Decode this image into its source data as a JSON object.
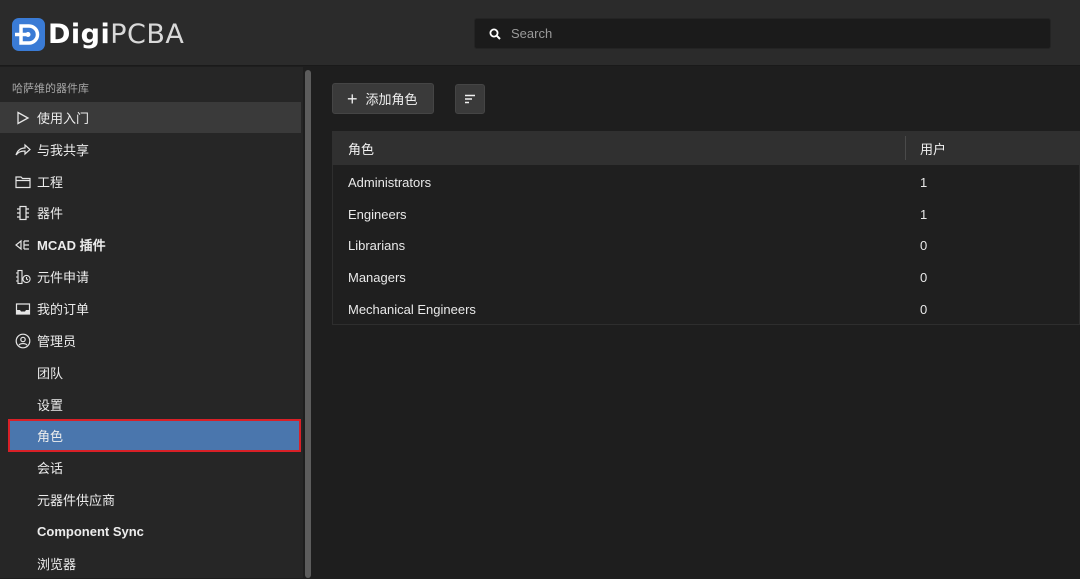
{
  "app": {
    "logo_bold": "Digi",
    "logo_thin": "PCBA"
  },
  "search": {
    "placeholder": "Search",
    "icon": "search-icon"
  },
  "sidebar": {
    "library_title": "哈萨维的器件库",
    "items": [
      {
        "label": "使用入门",
        "icon": "play-outline-icon"
      },
      {
        "label": "与我共享",
        "icon": "share-arrow-icon"
      },
      {
        "label": "工程",
        "icon": "folder-icon"
      },
      {
        "label": "器件",
        "icon": "chip-icon"
      },
      {
        "label": "MCAD 插件",
        "icon": "plugin-icon"
      },
      {
        "label": "元件申请",
        "icon": "component-request-icon"
      },
      {
        "label": "我的订单",
        "icon": "inbox-icon"
      },
      {
        "label": "管理员",
        "icon": "user-circle-icon"
      }
    ],
    "sub_items": [
      {
        "label": "团队"
      },
      {
        "label": "设置"
      },
      {
        "label": "角色",
        "active": true
      },
      {
        "label": "会话"
      },
      {
        "label": "元器件供应商"
      },
      {
        "label": "Component Sync"
      },
      {
        "label": "浏览器"
      }
    ]
  },
  "toolbar": {
    "add_role_label": "添加角色",
    "sort_icon": "sort-icon"
  },
  "table": {
    "columns": [
      "角色",
      "用户"
    ],
    "rows": [
      {
        "role": "Administrators",
        "users": "1"
      },
      {
        "role": "Engineers",
        "users": "1"
      },
      {
        "role": "Librarians",
        "users": "0"
      },
      {
        "role": "Managers",
        "users": "0"
      },
      {
        "role": "Mechanical Engineers",
        "users": "0"
      }
    ]
  },
  "colors": {
    "accent": "#3a7bd5",
    "active_item": "#4a76ad",
    "highlight_border": "#d92027"
  }
}
